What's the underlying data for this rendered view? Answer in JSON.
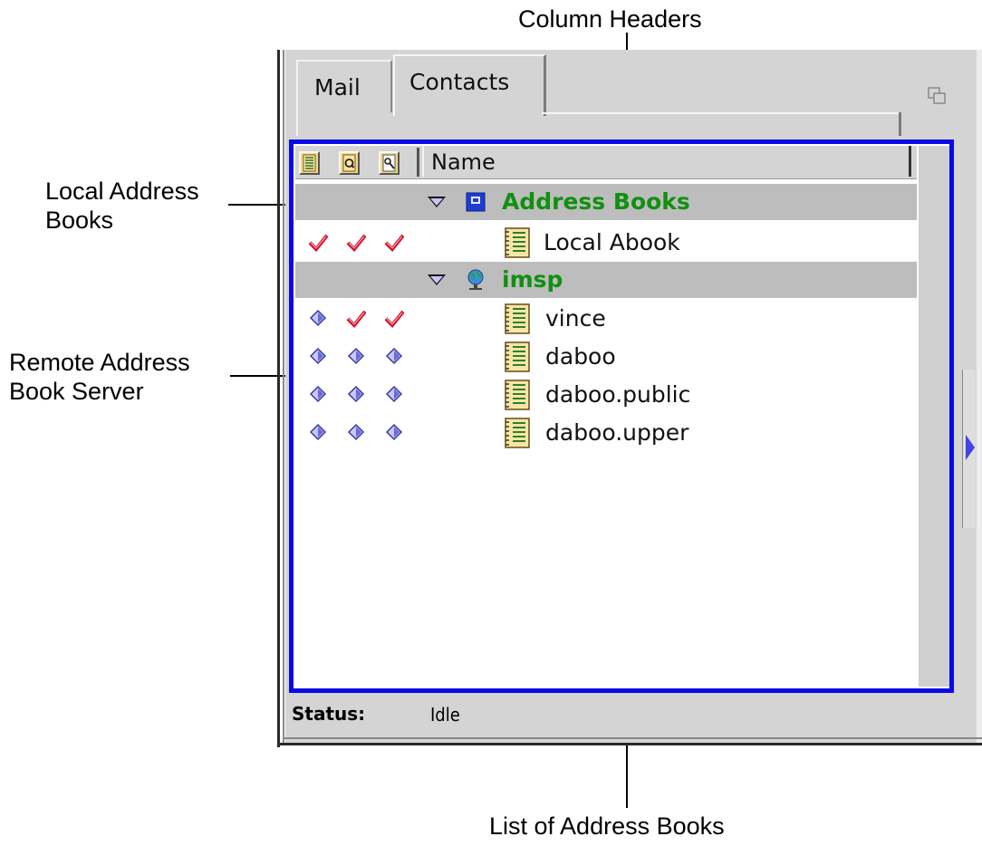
{
  "callouts": {
    "column_headers": "Column Headers",
    "local_address_books_line1": "Local Address",
    "local_address_books_line2": "Books",
    "remote_server_line1": "Remote Address",
    "remote_server_line2": "Book Server",
    "list_of_address_books": "List of Address Books"
  },
  "tabs": [
    {
      "label": "Mail",
      "selected": false
    },
    {
      "label": "Contacts",
      "selected": true
    }
  ],
  "list": {
    "header": {
      "status_icons": [
        "open-book-icon",
        "search-book-icon",
        "lookup-book-icon"
      ],
      "name_column": "Name"
    },
    "groups": [
      {
        "label": "Address Books",
        "icon": "local-disk-icon",
        "expanded": true,
        "items": [
          {
            "name": "Local Abook",
            "checks": [
              true,
              true,
              true
            ]
          }
        ]
      },
      {
        "label": "imsp",
        "icon": "globe-server-icon",
        "expanded": true,
        "items": [
          {
            "name": "vince",
            "checks": [
              false,
              true,
              true
            ]
          },
          {
            "name": "daboo",
            "checks": [
              false,
              false,
              false
            ]
          },
          {
            "name": "daboo.public",
            "checks": [
              false,
              false,
              false
            ]
          },
          {
            "name": "daboo.upper",
            "checks": [
              false,
              false,
              false
            ]
          }
        ]
      }
    ]
  },
  "status": {
    "label": "Status:",
    "value": "Idle"
  },
  "colors": {
    "highlight": "#0a0ae6",
    "group_text": "#119011",
    "group_bg": "#bdbdbd",
    "check_red": "#d10f2a",
    "diamond": "#6a6ad8"
  }
}
